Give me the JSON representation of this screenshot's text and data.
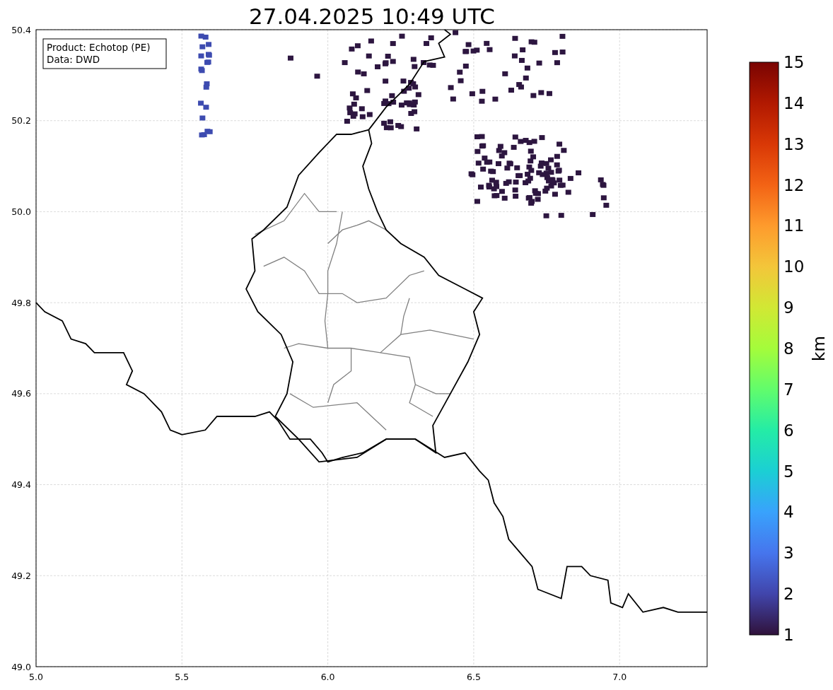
{
  "title": "27.04.2025 10:49 UTC",
  "info_box": {
    "lines": [
      "Product: Echotop (PE)",
      "Data: DWD"
    ]
  },
  "x_axis": {
    "ticks": [
      "5.0",
      "5.5",
      "6.0",
      "6.5",
      "7.0"
    ]
  },
  "y_axis": {
    "ticks": [
      "50.4",
      "50.2",
      "50.0",
      "49.8",
      "49.6",
      "49.4",
      "49.2",
      "49.0"
    ]
  },
  "colorbar": {
    "label": "km",
    "ticks": [
      "15",
      "14",
      "13",
      "12",
      "11",
      "10",
      "9",
      "8",
      "7",
      "6",
      "5",
      "4",
      "3",
      "2",
      "1"
    ]
  }
}
